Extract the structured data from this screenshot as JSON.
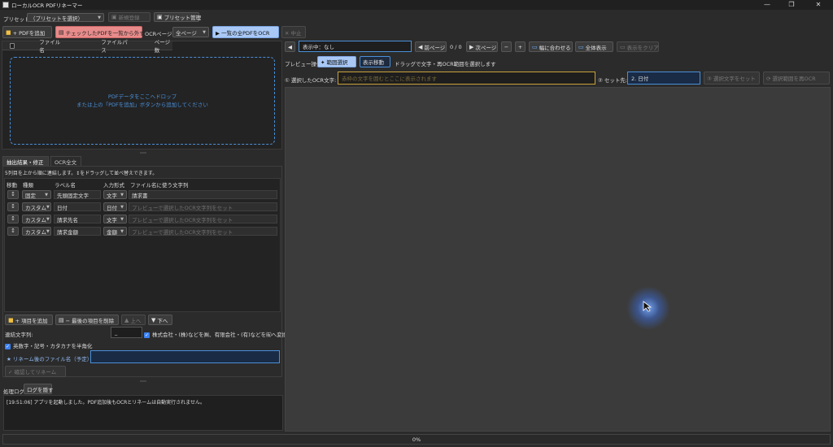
{
  "window": {
    "title": "ローカルOCR PDFリネーマー",
    "minimize": "—",
    "maximize": "❐",
    "close": "✕"
  },
  "toolbar": {
    "preset_label": "プリセット:",
    "preset_combo": "（プリセットを選択）",
    "new_register": "新規登録",
    "preset_manage": "プリセット管理",
    "add_pdf": "+ PDFを追加",
    "remove_checked": "チェックしたPDFを一覧から外す",
    "ocr_pages_label": "OCRページ:",
    "ocr_pages_combo": "全ページ",
    "ocr_all": "▶ 一覧の全PDFをOCR",
    "stop": "✕ 中止"
  },
  "file_table": {
    "headers": [
      "ファイル名",
      "ファイルパス",
      "ページ数"
    ],
    "drop_line1": "PDFデータをここへドロップ",
    "drop_line2": "または上の「PDFを追加」ボタンから追加してください"
  },
  "tabs": [
    "抽出結果・修正",
    "OCR全文"
  ],
  "extract": {
    "hint": "5列目を上から順に連結します。↕をドラッグして並べ替えできます。",
    "headers": [
      "移動",
      "種類",
      "ラベル名",
      "入力形式",
      "ファイル名に使う文字列"
    ],
    "rows": [
      {
        "mover": "↕",
        "kind": "固定",
        "label": "先頭固定文字",
        "format": "文字",
        "value": "請求書",
        "placeholder": false
      },
      {
        "mover": "↕",
        "kind": "カスタム",
        "label": "日付",
        "format": "日付",
        "value": "プレビューで選択したOCR文字列をセット",
        "placeholder": true
      },
      {
        "mover": "↕",
        "kind": "カスタム",
        "label": "請求先名",
        "format": "文字",
        "value": "プレビューで選択したOCR文字列をセット",
        "placeholder": true
      },
      {
        "mover": "↕",
        "kind": "カスタム",
        "label": "請求金額",
        "format": "金額",
        "value": "プレビューで選択したOCR文字列をセット",
        "placeholder": true
      }
    ],
    "add_item": "+ 項目を追加",
    "delete_last": "− 最後の項目を削除",
    "up": "上へ",
    "down": "下へ",
    "joiner_label": "連結文字列:",
    "joiner_value": "_",
    "company_replace": "株式会社・(株)などを㈱、有限会社・(有)などを㈲へ変換",
    "halfwidth": "英数字・記号・カタカナを半角化",
    "rename_label": "★ リネーム後のファイル名（予定）",
    "rename_value": "",
    "confirm_rename": "✓ 確認してリネーム"
  },
  "log": {
    "label": "処理ログ",
    "hide_button": "ログを隠す",
    "line": "[19:51:06] アプリを起動しました。PDF追加後もOCRとリネームは自動実行されません。"
  },
  "preview": {
    "nav_left": "◀",
    "showing": "表示中：なし",
    "prev_page": "前ページ",
    "page_count": "0 / 0",
    "next_page": "次ページ",
    "zoom_out": "−",
    "zoom_in": "+",
    "fit_width": "幅に合わせる",
    "fit_all": "全体表示",
    "clear_display": "表示をクリア",
    "ops_label": "プレビュー操作:",
    "range_select": "✦ 範囲選択",
    "pan": "表示移動",
    "ops_hint": "ドラッグで文字・再OCR範囲を選択します",
    "selected_label": "① 選択したOCR文字:",
    "selected_placeholder": "赤枠の文字を囲むとここに表示されます",
    "set_target_label": "② セット先:",
    "set_target_value": "2. 日付",
    "set_text": "③ 選択文字をセット",
    "re_ocr": "⟳ 選択範囲を再OCR"
  },
  "status": {
    "progress": "0%",
    "progress_value": 0
  },
  "colors": {
    "accent": "#3b82f6",
    "danger": "#e06666",
    "drop_border": "#4a8fd8",
    "highlight": "#c8a23a"
  }
}
